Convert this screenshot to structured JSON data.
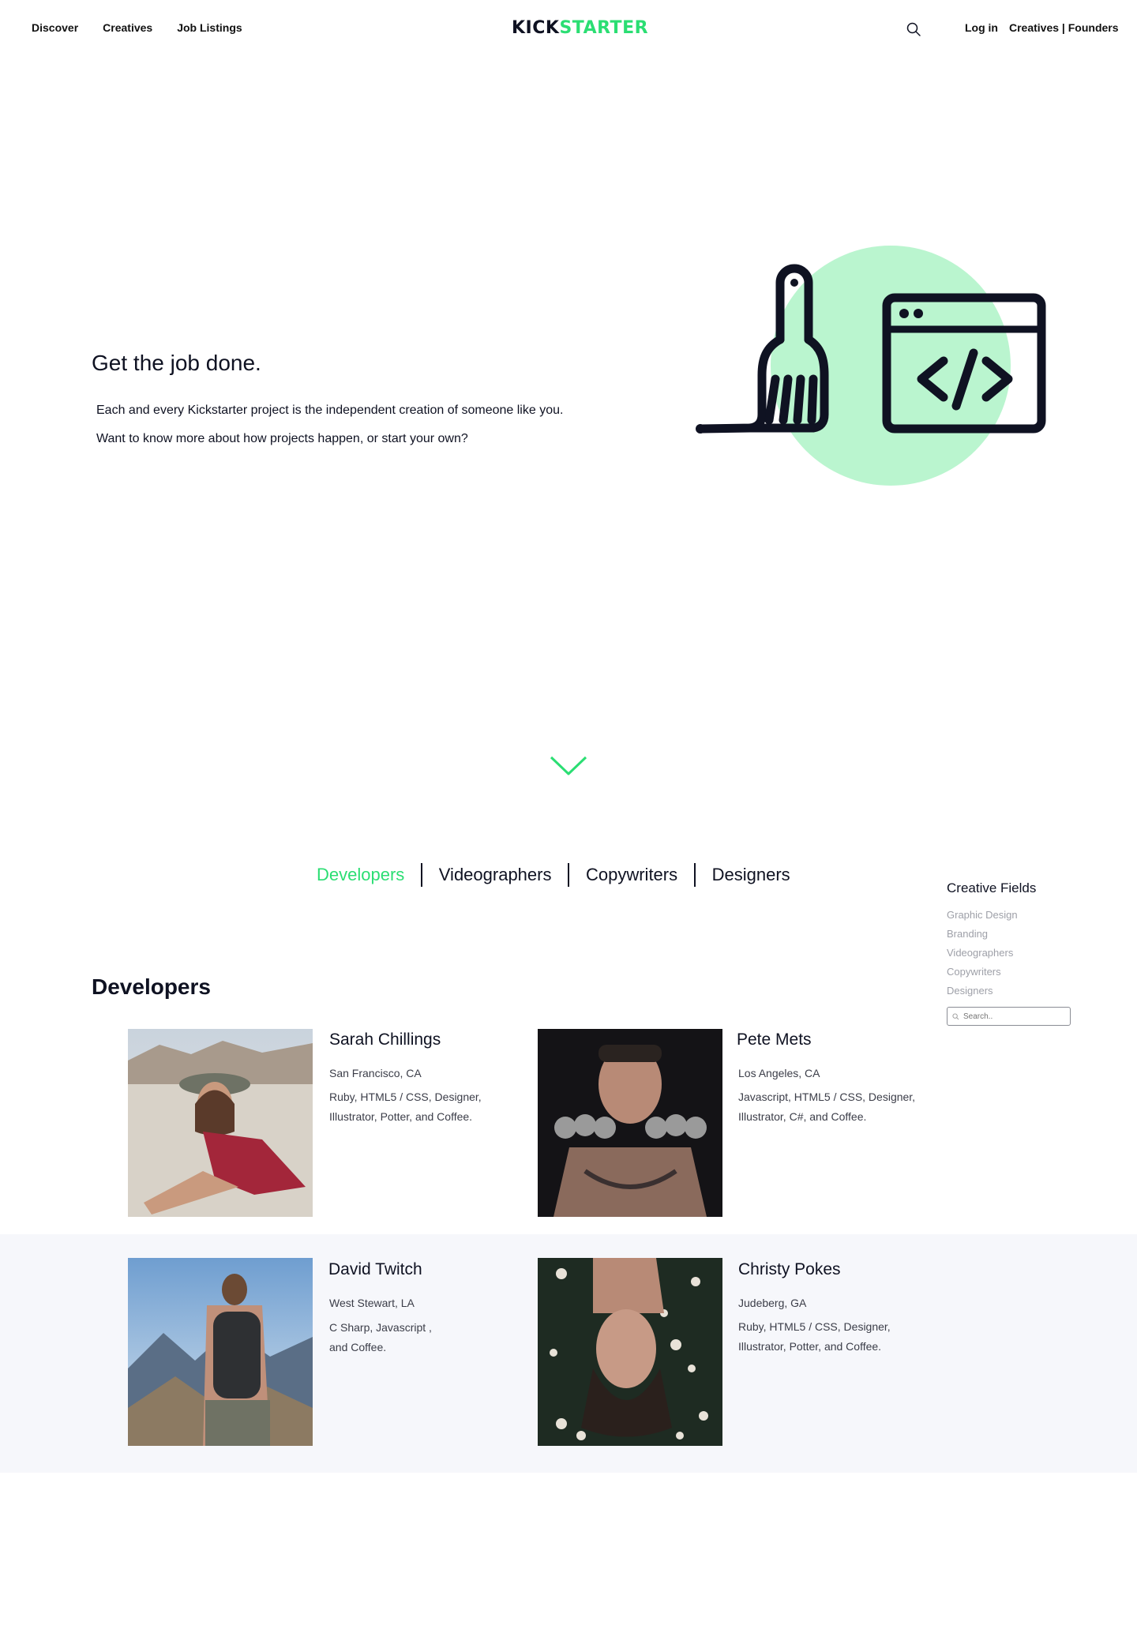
{
  "header": {
    "nav_left": [
      "Discover",
      "Creatives",
      "Job Listings"
    ],
    "logo_part1": "KICK",
    "logo_part2": "STARTER",
    "login": "Log in",
    "creatives_founders": "Creatives | Founders",
    "search_icon": "search-icon"
  },
  "hero": {
    "title": "Get the job done.",
    "line1": "Each and every Kickstarter project is the independent creation of someone like you.",
    "line2": "Want to know more about how projects happen, or start your own?",
    "illustration": "brush-and-code-window-illustration",
    "accent_color": "#baf5cf",
    "stroke_color": "#0f1222"
  },
  "scroll_icon": "chevron-down-icon",
  "tabs": [
    {
      "label": "Developers",
      "active": true
    },
    {
      "label": "Videographers",
      "active": false
    },
    {
      "label": "Copywriters",
      "active": false
    },
    {
      "label": "Designers",
      "active": false
    }
  ],
  "sidebar": {
    "title": "Creative Fields",
    "items": [
      "Graphic Design",
      "Branding",
      "Videographers",
      "Copywriters",
      "Designers"
    ],
    "search_placeholder": "Search.."
  },
  "section_title": "Developers",
  "people": [
    {
      "name": "Sarah Chillings",
      "location": "San Francisco, CA",
      "skills": "Ruby, HTML5 / CSS, Designer, Illustrator, Potter, and Coffee."
    },
    {
      "name": "Pete Mets",
      "location": "Los Angeles, CA",
      "skills": "Javascript, HTML5 / CSS, Designer, Illustrator, C#, and Coffee."
    },
    {
      "name": "David Twitch",
      "location": "West Stewart, LA",
      "skills": "C Sharp, Javascript , and Coffee."
    },
    {
      "name": "Christy Pokes",
      "location": "Judeberg, GA",
      "skills": "Ruby, HTML5 / CSS, Designer, Illustrator, Potter, and Coffee."
    }
  ],
  "colors": {
    "brand_green": "#2bde73",
    "dark_text": "#0f1222",
    "muted_text": "#9ea0a8",
    "row_alt_bg": "#f6f7fb"
  }
}
